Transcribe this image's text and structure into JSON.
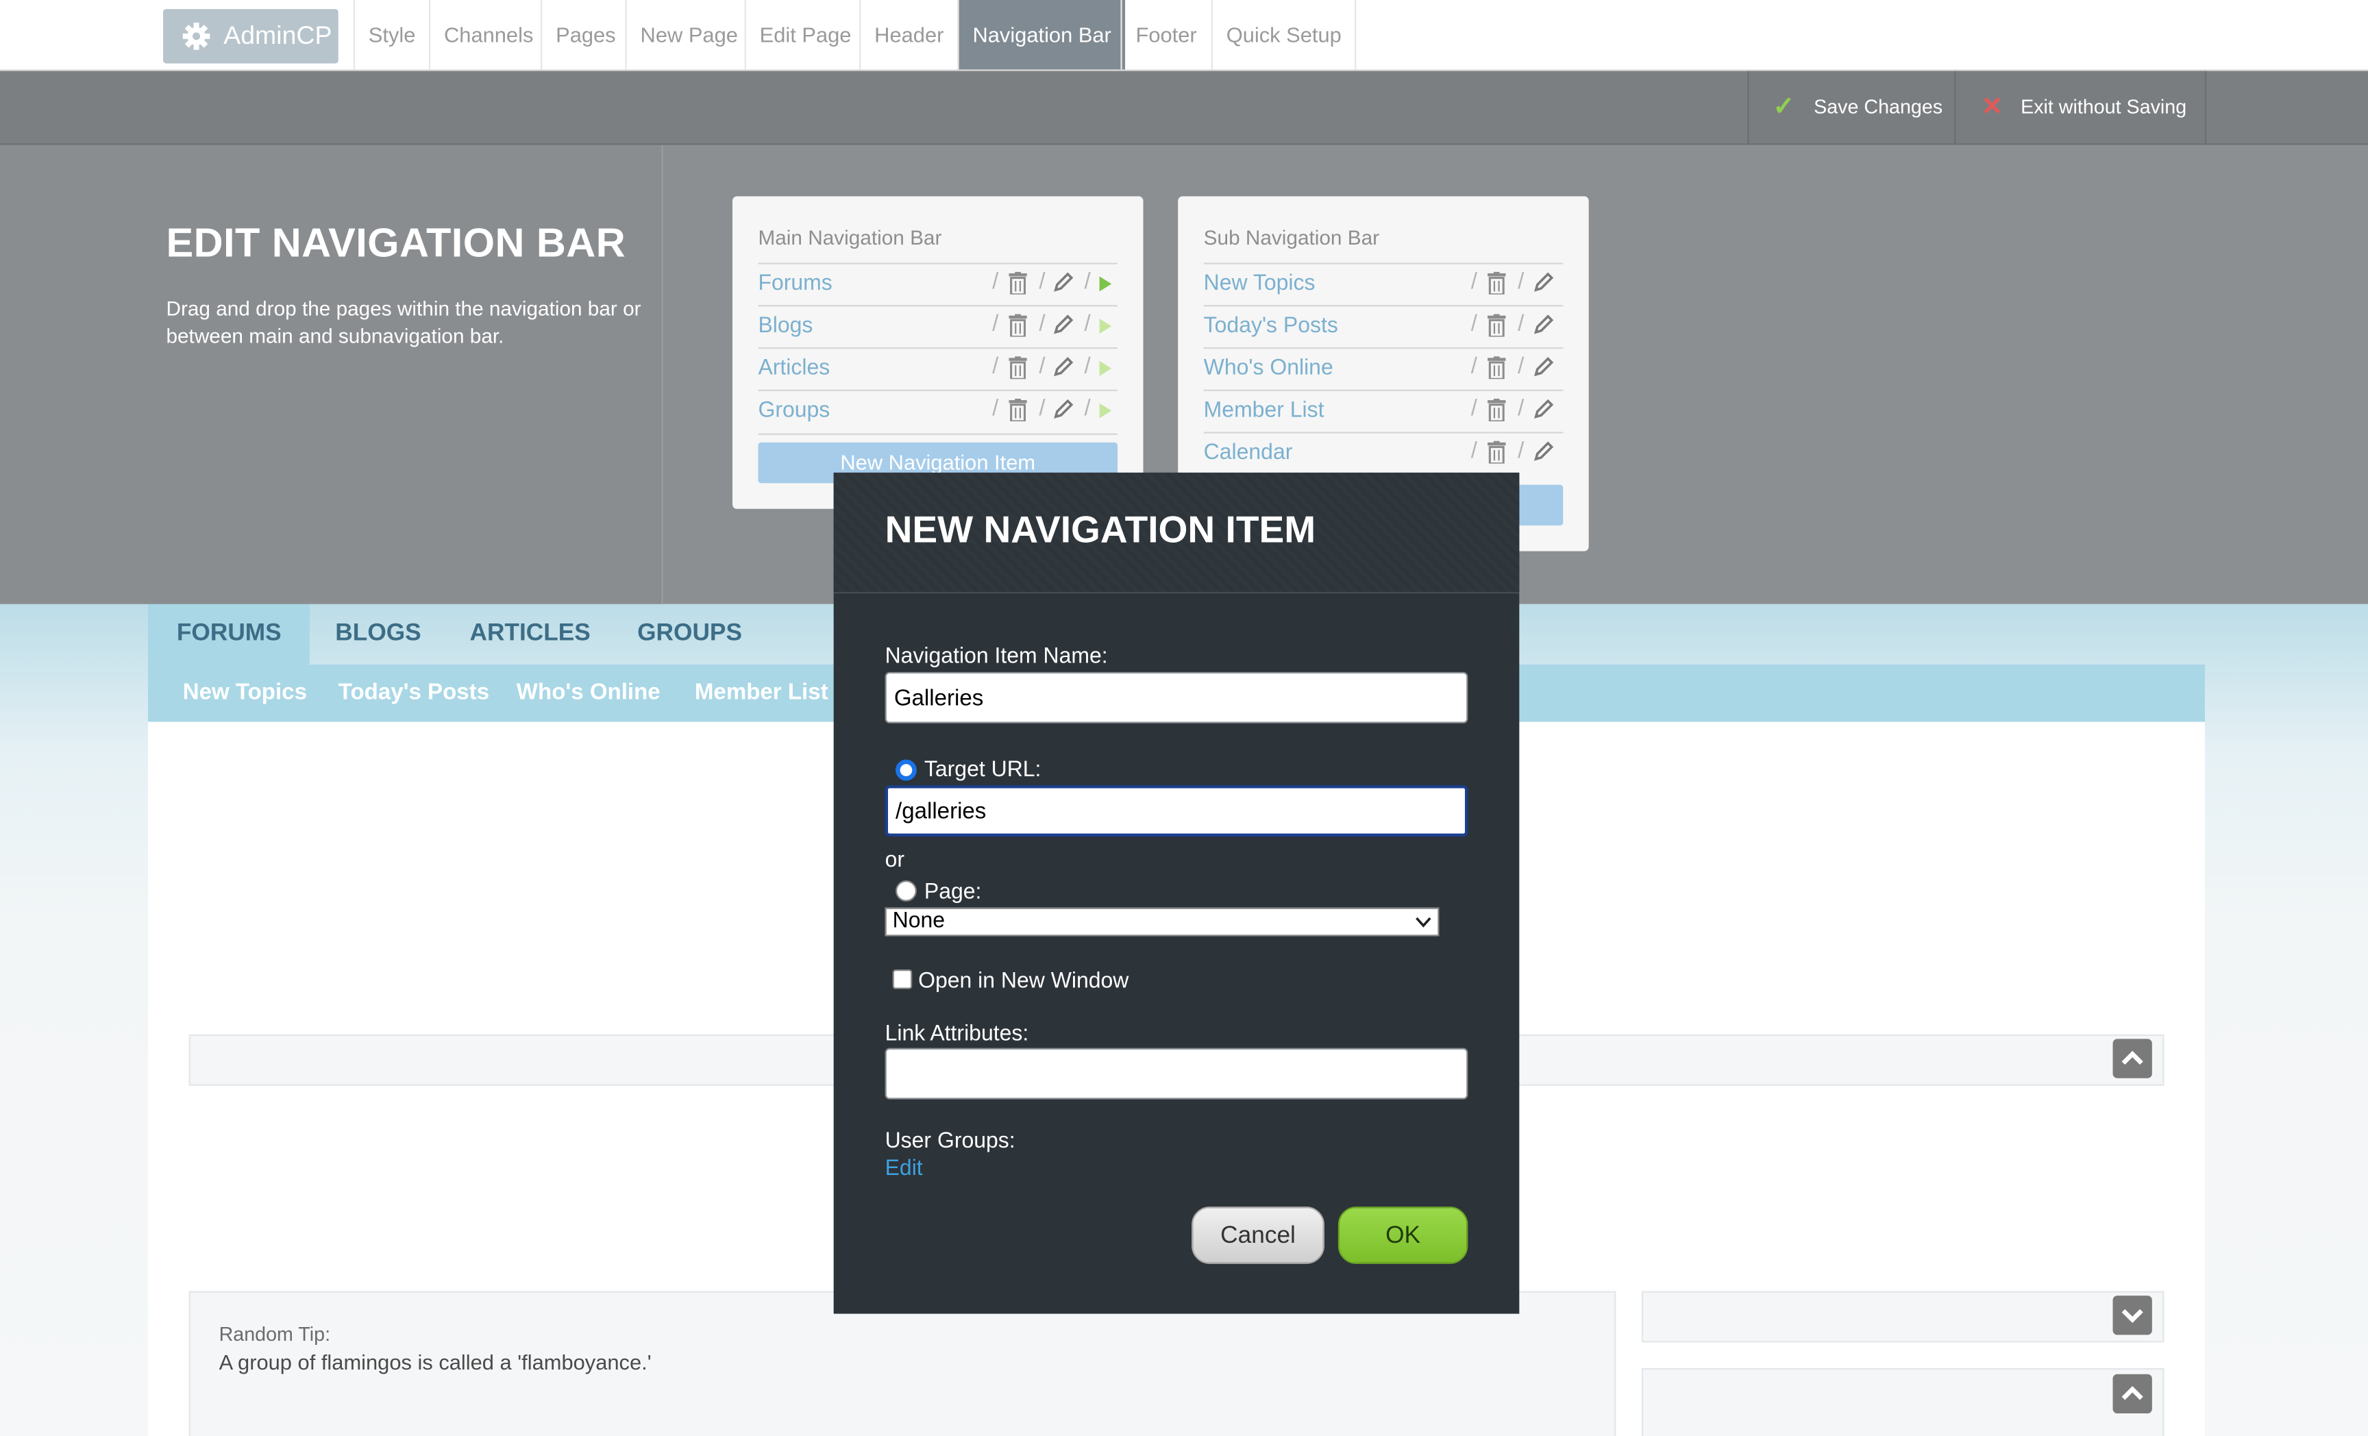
{
  "admin_bar": {
    "brand": "AdminCP",
    "nav": [
      "Style",
      "Channels",
      "Pages",
      "New Page",
      "Edit Page",
      "Header",
      "Navigation Bar",
      "Footer",
      "Quick Setup"
    ],
    "active": "Navigation Bar"
  },
  "toolbar": {
    "save_label": "Save Changes",
    "exit_label": "Exit without Saving"
  },
  "editor": {
    "title": "EDIT NAVIGATION BAR",
    "description": "Drag and drop the pages within the navigation bar or between main and subnavigation bar."
  },
  "main_nav": {
    "title": "Main Navigation Bar",
    "items": [
      "Forums",
      "Blogs",
      "Articles",
      "Groups"
    ],
    "new_button": "New Navigation Item"
  },
  "sub_nav": {
    "title": "Sub Navigation Bar",
    "items": [
      "New Topics",
      "Today's Posts",
      "Who's Online",
      "Member List",
      "Calendar"
    ]
  },
  "site_preview": {
    "tabs": [
      "FORUMS",
      "BLOGS",
      "ARTICLES",
      "GROUPS"
    ],
    "subtabs": [
      "New Topics",
      "Today's Posts",
      "Who's Online",
      "Member List"
    ],
    "tip_label": "Random Tip:",
    "tip_text": "A group of flamingos is called a 'flamboyance.'"
  },
  "modal": {
    "title": "NEW NAVIGATION ITEM",
    "name_label": "Navigation Item Name:",
    "name_value": "Galleries",
    "target_url_label": "Target URL:",
    "target_url_value": "/galleries",
    "or_label": "or",
    "page_label": "Page:",
    "page_value": "None",
    "new_window_label": "Open in New Window",
    "link_attributes_label": "Link Attributes:",
    "link_attributes_value": "",
    "user_groups_label": "User Groups:",
    "user_groups_edit": "Edit",
    "cancel_label": "Cancel",
    "ok_label": "OK"
  },
  "colors": {
    "accent_link": "#7bb0cf",
    "ok_green": "#8ccd3a",
    "modal_bg": "#2c3339",
    "radio_blue": "#1a73e8"
  },
  "icons": {
    "gear": "gear-icon",
    "check": "check-icon",
    "close": "close-icon",
    "trash": "trash-icon",
    "pencil": "pencil-icon",
    "play": "play-icon",
    "chevron_up": "chevron-up-icon",
    "chevron_down": "chevron-down-icon"
  }
}
